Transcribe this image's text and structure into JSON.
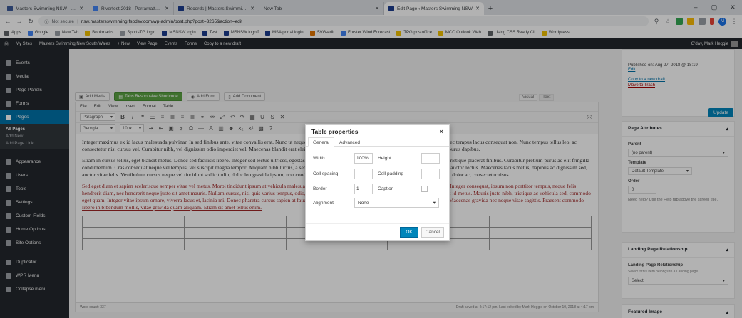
{
  "browser": {
    "tabs": [
      {
        "label": "Masters Swimming NSW - Home",
        "favicon_color": "#3b5998"
      },
      {
        "label": "Riverfest 2018 | Parramatta River",
        "favicon_color": "#4285f4"
      },
      {
        "label": "Records | Masters Swimming NSW",
        "favicon_color": "#1a3c8f"
      },
      {
        "label": "New Tab",
        "favicon_color": ""
      },
      {
        "label": "Edit Page ‹ Masters Swimming NSW",
        "favicon_color": "#1a3c8f",
        "active": true
      }
    ],
    "new_tab": "+",
    "window_controls": {
      "minimize": "–",
      "maximize": "▢",
      "close": "✕"
    },
    "address": {
      "security": "Not secure",
      "url": "nsw.mastersswimming.fspdev.com/wp-admin/post.php?post=3265&action=edit"
    },
    "avatar_letter": "M",
    "bookmarks": [
      {
        "label": "Apps",
        "color": "#5f6368"
      },
      {
        "label": "Google",
        "color": "#4285f4"
      },
      {
        "label": "New Tab",
        "color": "#9aa0a6"
      },
      {
        "label": "Bookmarks",
        "color": "#f2c200"
      },
      {
        "label": "SportsTG login",
        "color": "#9aa0a6"
      },
      {
        "label": "MSNSW login",
        "color": "#1a3c8f"
      },
      {
        "label": "Test",
        "color": "#1a3c8f"
      },
      {
        "label": "MSNSW logoff",
        "color": "#1a3c8f"
      },
      {
        "label": "MSA portal login",
        "color": "#1a3c8f"
      },
      {
        "label": "SVG-edit",
        "color": "#e37400"
      },
      {
        "label": "Forster Wind Forecast",
        "color": "#4285f4"
      },
      {
        "label": "TPG postoffice",
        "color": "#f2c200"
      },
      {
        "label": "MCC Outlook Web",
        "color": "#f2c200"
      },
      {
        "label": "Using CSS Ready Cli",
        "color": "#5f6368"
      },
      {
        "label": "Wordpress",
        "color": "#f2c200"
      }
    ]
  },
  "adminbar": {
    "items": [
      "My Sites",
      "Masters Swimming New South Wales",
      "+ New",
      "View Page",
      "Events",
      "Forms",
      "Copy to a new draft"
    ],
    "greeting": "G'day, Mark Heggie"
  },
  "sidebar": {
    "items": [
      {
        "label": "Events"
      },
      {
        "label": "Media"
      },
      {
        "label": "Page Panels"
      },
      {
        "label": "Forms"
      },
      {
        "label": "Pages",
        "current": true
      }
    ],
    "submenu": [
      {
        "label": "All Pages",
        "bold": true
      },
      {
        "label": "Add New"
      },
      {
        "label": "Add Page Link"
      }
    ],
    "items2": [
      {
        "label": "Appearance"
      },
      {
        "label": "Users"
      },
      {
        "label": "Tools"
      },
      {
        "label": "Settings"
      },
      {
        "label": "Custom Fields"
      },
      {
        "label": "Home Options"
      },
      {
        "label": "Site Options"
      },
      {
        "label": "Duplicator"
      },
      {
        "label": "WPR Menu"
      },
      {
        "label": "Collapse menu"
      }
    ]
  },
  "editor": {
    "buttons": {
      "add_media": "Add Media",
      "tabs_shortcode": "Tabs Responsive Shortcode",
      "add_form": "Add Form",
      "add_document": "Add Document"
    },
    "view_tabs": {
      "visual": "Visual",
      "text": "Text"
    },
    "menus": [
      "File",
      "Edit",
      "View",
      "Insert",
      "Format",
      "Table"
    ],
    "format_select": "Paragraph",
    "font_select": "Georgia",
    "size_select": "10px",
    "paragraphs": [
      "Integer maximus ex id lacus malesuada pulvinar. In sed finibus ante, vitae convallis erat. Nunc ut neque ante. Maecenas velit erat, gravida a. Donec porttitor felis purus, nec tempus lacus consequat non. Nunc tempus tellus leo, ac consectetur nisi cursus vel. Curabitur nibh, vel dignissim odio imperdiet vel. Maecenas blandit erat eleifend et. Vivamus lacinia neque ornare lorem tincidunt, sed ornare purus dapibus.",
      "Etiam in cursus tellus, eget blandit metus. Donec sed facilisis libero. Integer sed lectus ultrices, egestas elit non, aliquet tellus. Nam mi. Donec nec accumsan est. Mauris tristique placerat finibus. Curabitur pretium purus ac elit fringilla condimentum. Cras consequat neque vel tempus, vel suscipit magna tempor. Aliquam nibh luctus, a semper libero convallis. Sed urna erat, hendrerit nec odio ex, rhoncus auctor lectus. Maecenas lacus metus, dapibus ac dignissim sed, auctor vitae felis. Vestibulum cursus neque vel tincidunt sollicitudin, dolor leo gravida ipsum, non condimentum sapien ex sollicitudin elit. Ut id urna bibendum, hendrerit dolor ac, consectetur risus.",
      "Sed eget diam et sapien scelerisque semper vitae vel metus. Morbi tincidunt ipsum at vehicula malesuada. Aliquam erat volutpat. Morbi purus. Nam rutrum sodales urna. Integer consequat, ipsum non porttitor tempus, neque felis hendrerit diam, nec hendrerit neque justo sit amet mauris. Nullam cursus, nisl quis varius tempus, odio, a mollis sapien. Proin quis elit at justo scelerisque elementum eget id metus. Mauris justo nibh, tristique ac vehicula sed, commodo eget quam. Integer vitae ipsum ornare, viverra lacus et, lacinia mi. Donec pharetra cursus sapien at faucibus. Duis sit amet nibh porta, tincidunt arcu nec, pretium sapien. Maecenas gravida nec neque vitae sagittis. Praesent commodo libero in bibendum mollis, vitae gravida quam aliquam. Etiam sit amet tellus enim."
    ],
    "word_count": "Word count: 337",
    "draft_saved": "Draft saved at 4:17:12 pm. Last edited by Mark Heggie on October 10, 2018 at 4:17 pm"
  },
  "right_sidebar": {
    "publish_text": "Published on: Aug 27, 2018 @ 18:19",
    "edit_link": "Edit",
    "copy_link": "Copy to a new draft",
    "trash_link": "Move to Trash",
    "update": "Update",
    "page_attributes": {
      "title": "Page Attributes",
      "parent_label": "Parent",
      "parent_value": "(no parent)",
      "template_label": "Template",
      "template_value": "Default Template",
      "order_label": "Order",
      "order_value": "0",
      "help": "Need help? Use the Help tab above the screen title."
    },
    "landing": {
      "title": "Landing Page Relationship",
      "subtitle": "Landing Page Relationship",
      "desc": "Select if this item belongs to a Landing page.",
      "select": "Select"
    },
    "featured": {
      "title": "Featured Image"
    }
  },
  "dialog": {
    "title": "Table properties",
    "close": "×",
    "tabs": [
      "General",
      "Advanced"
    ],
    "width_label": "Width",
    "width_value": "100%",
    "height_label": "Height",
    "cell_spacing_label": "Cell spacing",
    "cell_padding_label": "Cell padding",
    "border_label": "Border",
    "border_value": "1",
    "caption_label": "Caption",
    "alignment_label": "Alignment",
    "alignment_value": "None",
    "ok": "OK",
    "cancel": "Cancel"
  }
}
